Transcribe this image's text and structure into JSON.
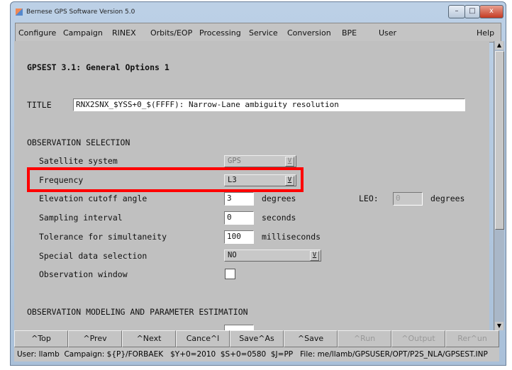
{
  "window": {
    "title": "Bernese GPS Software Version 5.0",
    "min": "–",
    "max": "□",
    "close": "x"
  },
  "menu": [
    {
      "label": "Configure"
    },
    {
      "label": "Campaign"
    },
    {
      "label": "RINEX"
    },
    {
      "label": "Orbits/EOP"
    },
    {
      "label": "Processing"
    },
    {
      "label": "Service"
    },
    {
      "label": "Conversion"
    },
    {
      "label": "BPE"
    },
    {
      "label": "User"
    },
    {
      "label": "Help"
    }
  ],
  "panel": {
    "heading": "GPSEST 3.1: General Options 1",
    "title_label": "TITLE",
    "title_value": "RNX2SNX_$YSS+0_$(FFFF): Narrow-Lane ambiguity resolution",
    "section1": "OBSERVATION SELECTION",
    "satellite_label": "Satellite system",
    "satellite_value": "GPS",
    "frequency_label": "Frequency",
    "frequency_value": "L3",
    "elevation_label": "Elevation cutoff angle",
    "elevation_value": "3",
    "elevation_unit": "degrees",
    "leo_label": "LEO:",
    "leo_value": "0",
    "leo_unit": "degrees",
    "sampling_label": "Sampling interval",
    "sampling_value": "0",
    "sampling_unit": "seconds",
    "tolerance_label": "Tolerance for simultaneity",
    "tolerance_value": "100",
    "tolerance_unit": "milliseconds",
    "special_label": "Special data selection",
    "special_value": "NO",
    "window_label": "Observation window",
    "window_checked": false,
    "section2": "OBSERVATION MODELING AND PARAMETER ESTIMATION",
    "combo_arrow": "V",
    "highlight_color": "#ff0000"
  },
  "buttons": [
    {
      "label": "^Top",
      "enabled": true
    },
    {
      "label": "^Prev",
      "enabled": true
    },
    {
      "label": "^Next",
      "enabled": true
    },
    {
      "label": "Cance^l",
      "enabled": true
    },
    {
      "label": "Save^As",
      "enabled": true
    },
    {
      "label": "^Save",
      "enabled": true
    },
    {
      "label": "^Run",
      "enabled": false
    },
    {
      "label": "^Output",
      "enabled": false
    },
    {
      "label": "Rer^un",
      "enabled": false
    }
  ],
  "status": "User: llamb  Campaign: ${P}/FORBAEK   $Y+0=2010  $S+0=0580  $J=PP   File: me/llamb/GPSUSER/OPT/P2S_NLA/GPSEST.INP"
}
